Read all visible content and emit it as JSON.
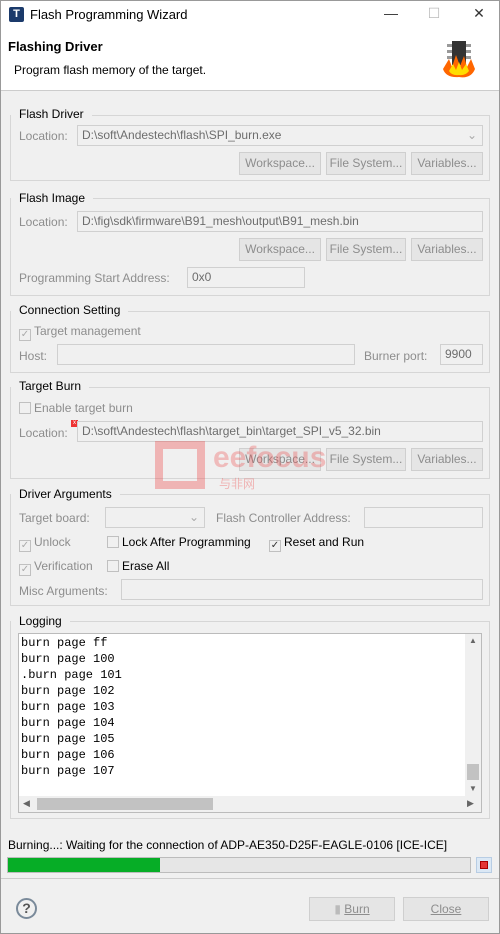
{
  "window": {
    "title": "Flash Programming Wizard"
  },
  "header": {
    "title": "Flashing Driver",
    "subtitle": "Program flash memory of the target."
  },
  "flash_driver": {
    "title": "Flash Driver",
    "location_label": "Location:",
    "location": "D:\\soft\\Andestech\\flash\\SPI_burn.exe",
    "workspace": "Workspace...",
    "filesystem": "File System...",
    "variables": "Variables..."
  },
  "flash_image": {
    "title": "Flash Image",
    "location_label": "Location:",
    "location": "D:\\fig\\sdk\\firmware\\B91_mesh\\output\\B91_mesh.bin",
    "workspace": "Workspace...",
    "filesystem": "File System...",
    "variables": "Variables...",
    "start_label": "Programming Start Address:",
    "start": "0x0"
  },
  "connection": {
    "title": "Connection Setting",
    "target_mgmt": "Target management",
    "target_mgmt_checked": true,
    "host_label": "Host:",
    "host": "",
    "port_label": "Burner port:",
    "port": "9900"
  },
  "target_burn": {
    "title": "Target Burn",
    "enable": "Enable target burn",
    "enable_checked": false,
    "location_label": "Location:",
    "location": "D:\\soft\\Andestech\\flash\\target_bin\\target_SPI_v5_32.bin",
    "workspace": "Workspace...",
    "filesystem": "File System...",
    "variables": "Variables..."
  },
  "driver_args": {
    "title": "Driver Arguments",
    "board_label": "Target board:",
    "board": "",
    "fca_label": "Flash Controller Address:",
    "fca": "",
    "unlock": "Unlock",
    "lock": "Lock After Programming",
    "reset": "Reset and Run",
    "verification": "Verification",
    "erase": "Erase All",
    "misc_label": "Misc Arguments:",
    "misc": ""
  },
  "logging": {
    "title": "Logging",
    "lines": [
      "burn page ff",
      "burn page 100",
      ".burn page 101",
      "burn page 102",
      "burn page 103",
      "burn page 104",
      "burn page 105",
      "burn page 106",
      "burn page 107"
    ]
  },
  "status": {
    "text": "Burning...: Waiting for the connection of ADP-AE350-D25F-EAGLE-0106 [ICE-ICE]",
    "progress_percent": 33,
    "progress_color": "#06ad26"
  },
  "footer": {
    "burn": "Burn",
    "close": "Close"
  },
  "watermark": {
    "text": "eefocus",
    "sub": "与非网"
  }
}
